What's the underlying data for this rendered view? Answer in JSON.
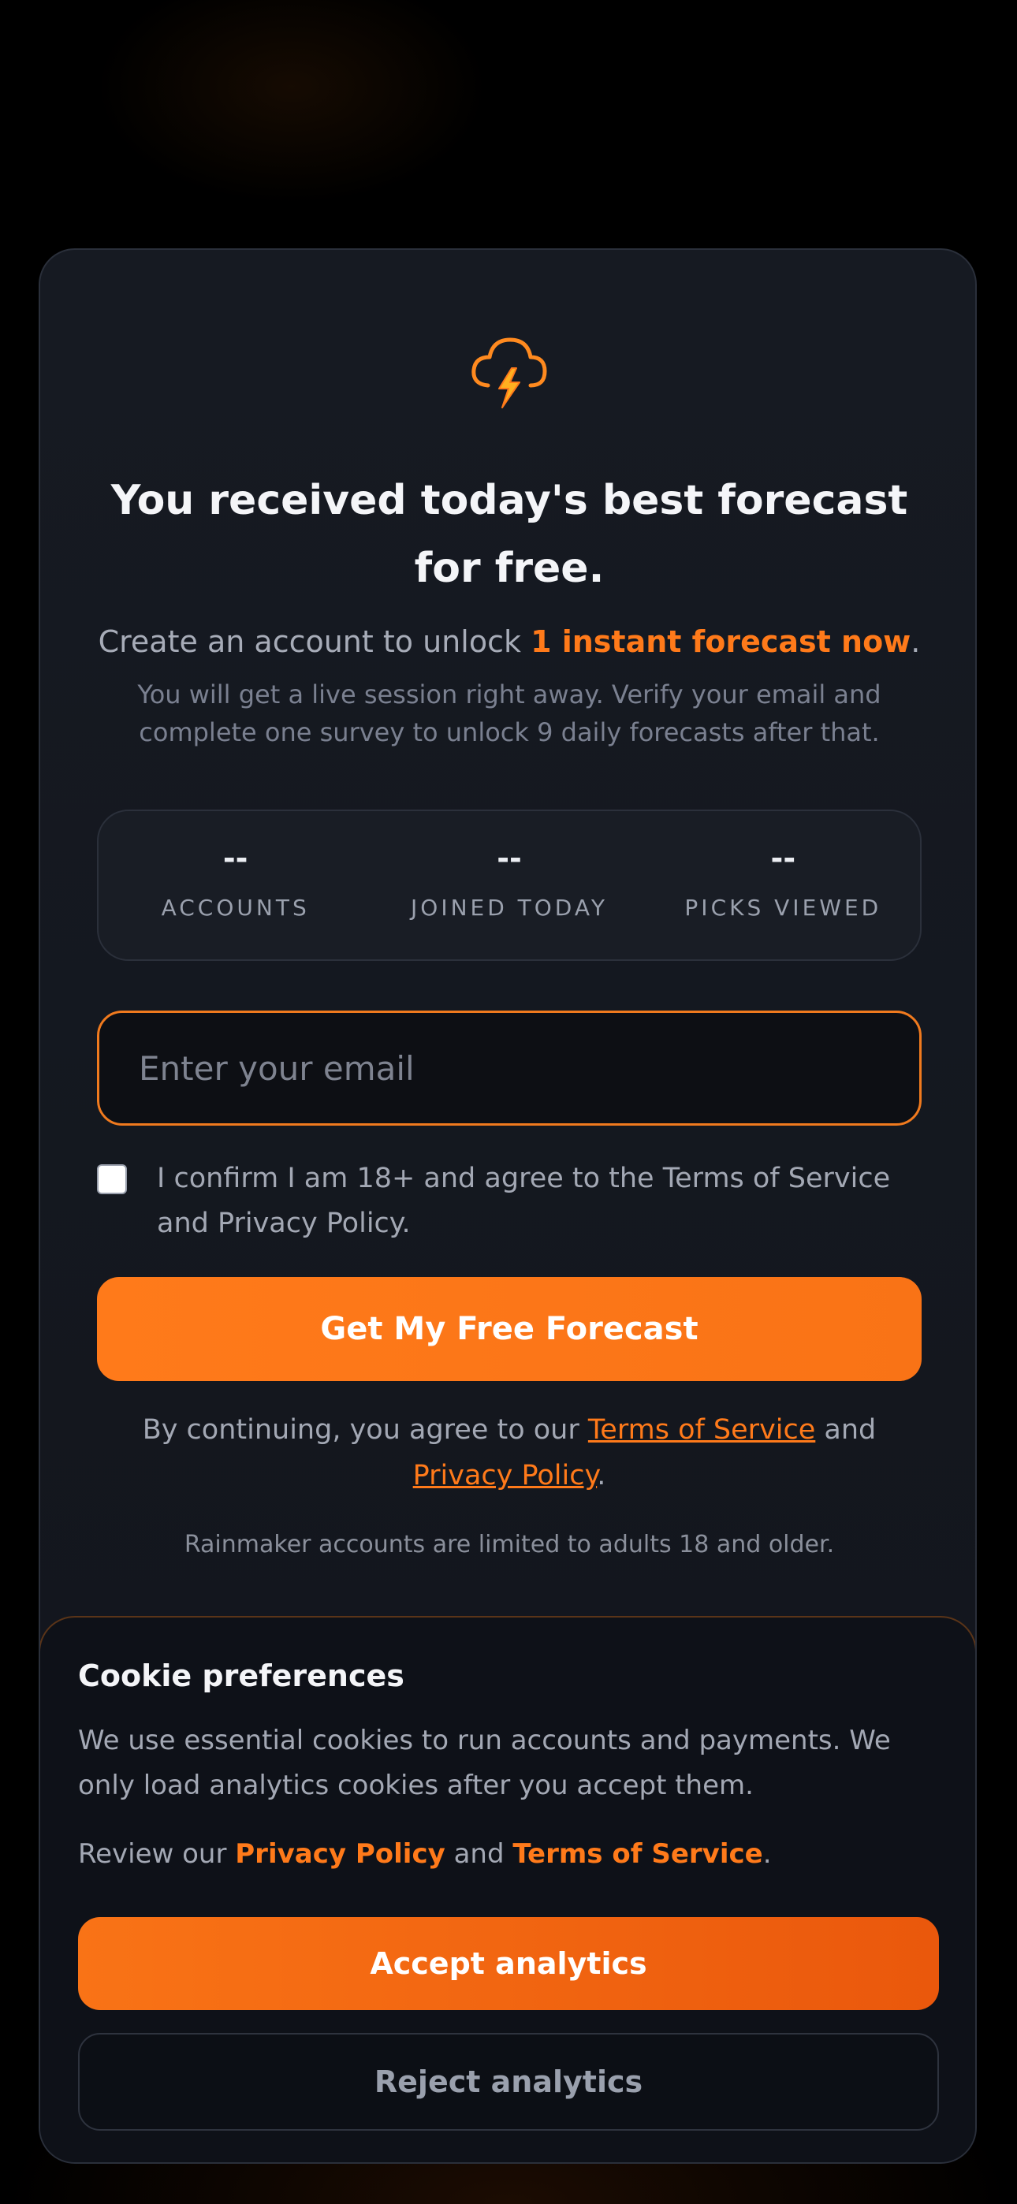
{
  "card": {
    "logo_icon": "storm-cloud-lightning-icon",
    "headline": "You received today's best forecast for free.",
    "subline_prefix": "Create an account to unlock ",
    "subline_highlight": "1 instant forecast now",
    "subline_suffix": ".",
    "detail": "You will get a live session right away. Verify your email and complete one survey to unlock 9 daily forecasts after that."
  },
  "stats": [
    {
      "value": "--",
      "label": "ACCOUNTS"
    },
    {
      "value": "--",
      "label": "JOINED TODAY"
    },
    {
      "value": "--",
      "label": "PICKS VIEWED"
    }
  ],
  "form": {
    "email_placeholder": "Enter your email",
    "email_value": "",
    "consent_checked": false,
    "consent_label": "I confirm I am 18+ and agree to the Terms of Service and Privacy Policy.",
    "submit_label": "Get My Free Forecast"
  },
  "terms": {
    "prefix": "By continuing, you agree to our ",
    "tos_link": "Terms of Service",
    "middle": " and ",
    "privacy_link": "Privacy Policy",
    "suffix": "."
  },
  "age_notice": "Rainmaker accounts are limited to adults 18 and older.",
  "cookie": {
    "title": "Cookie preferences",
    "body": "We use essential cookies to run accounts and payments. We only load analytics cookies after you accept them.",
    "review_prefix": "Review our ",
    "privacy_link": "Privacy Policy",
    "review_middle": " and ",
    "tos_link": "Terms of Service",
    "review_suffix": ".",
    "accept_label": "Accept analytics",
    "reject_label": "Reject analytics"
  },
  "colors": {
    "accent": "#f97316",
    "background": "#000000",
    "card": "#141820"
  }
}
